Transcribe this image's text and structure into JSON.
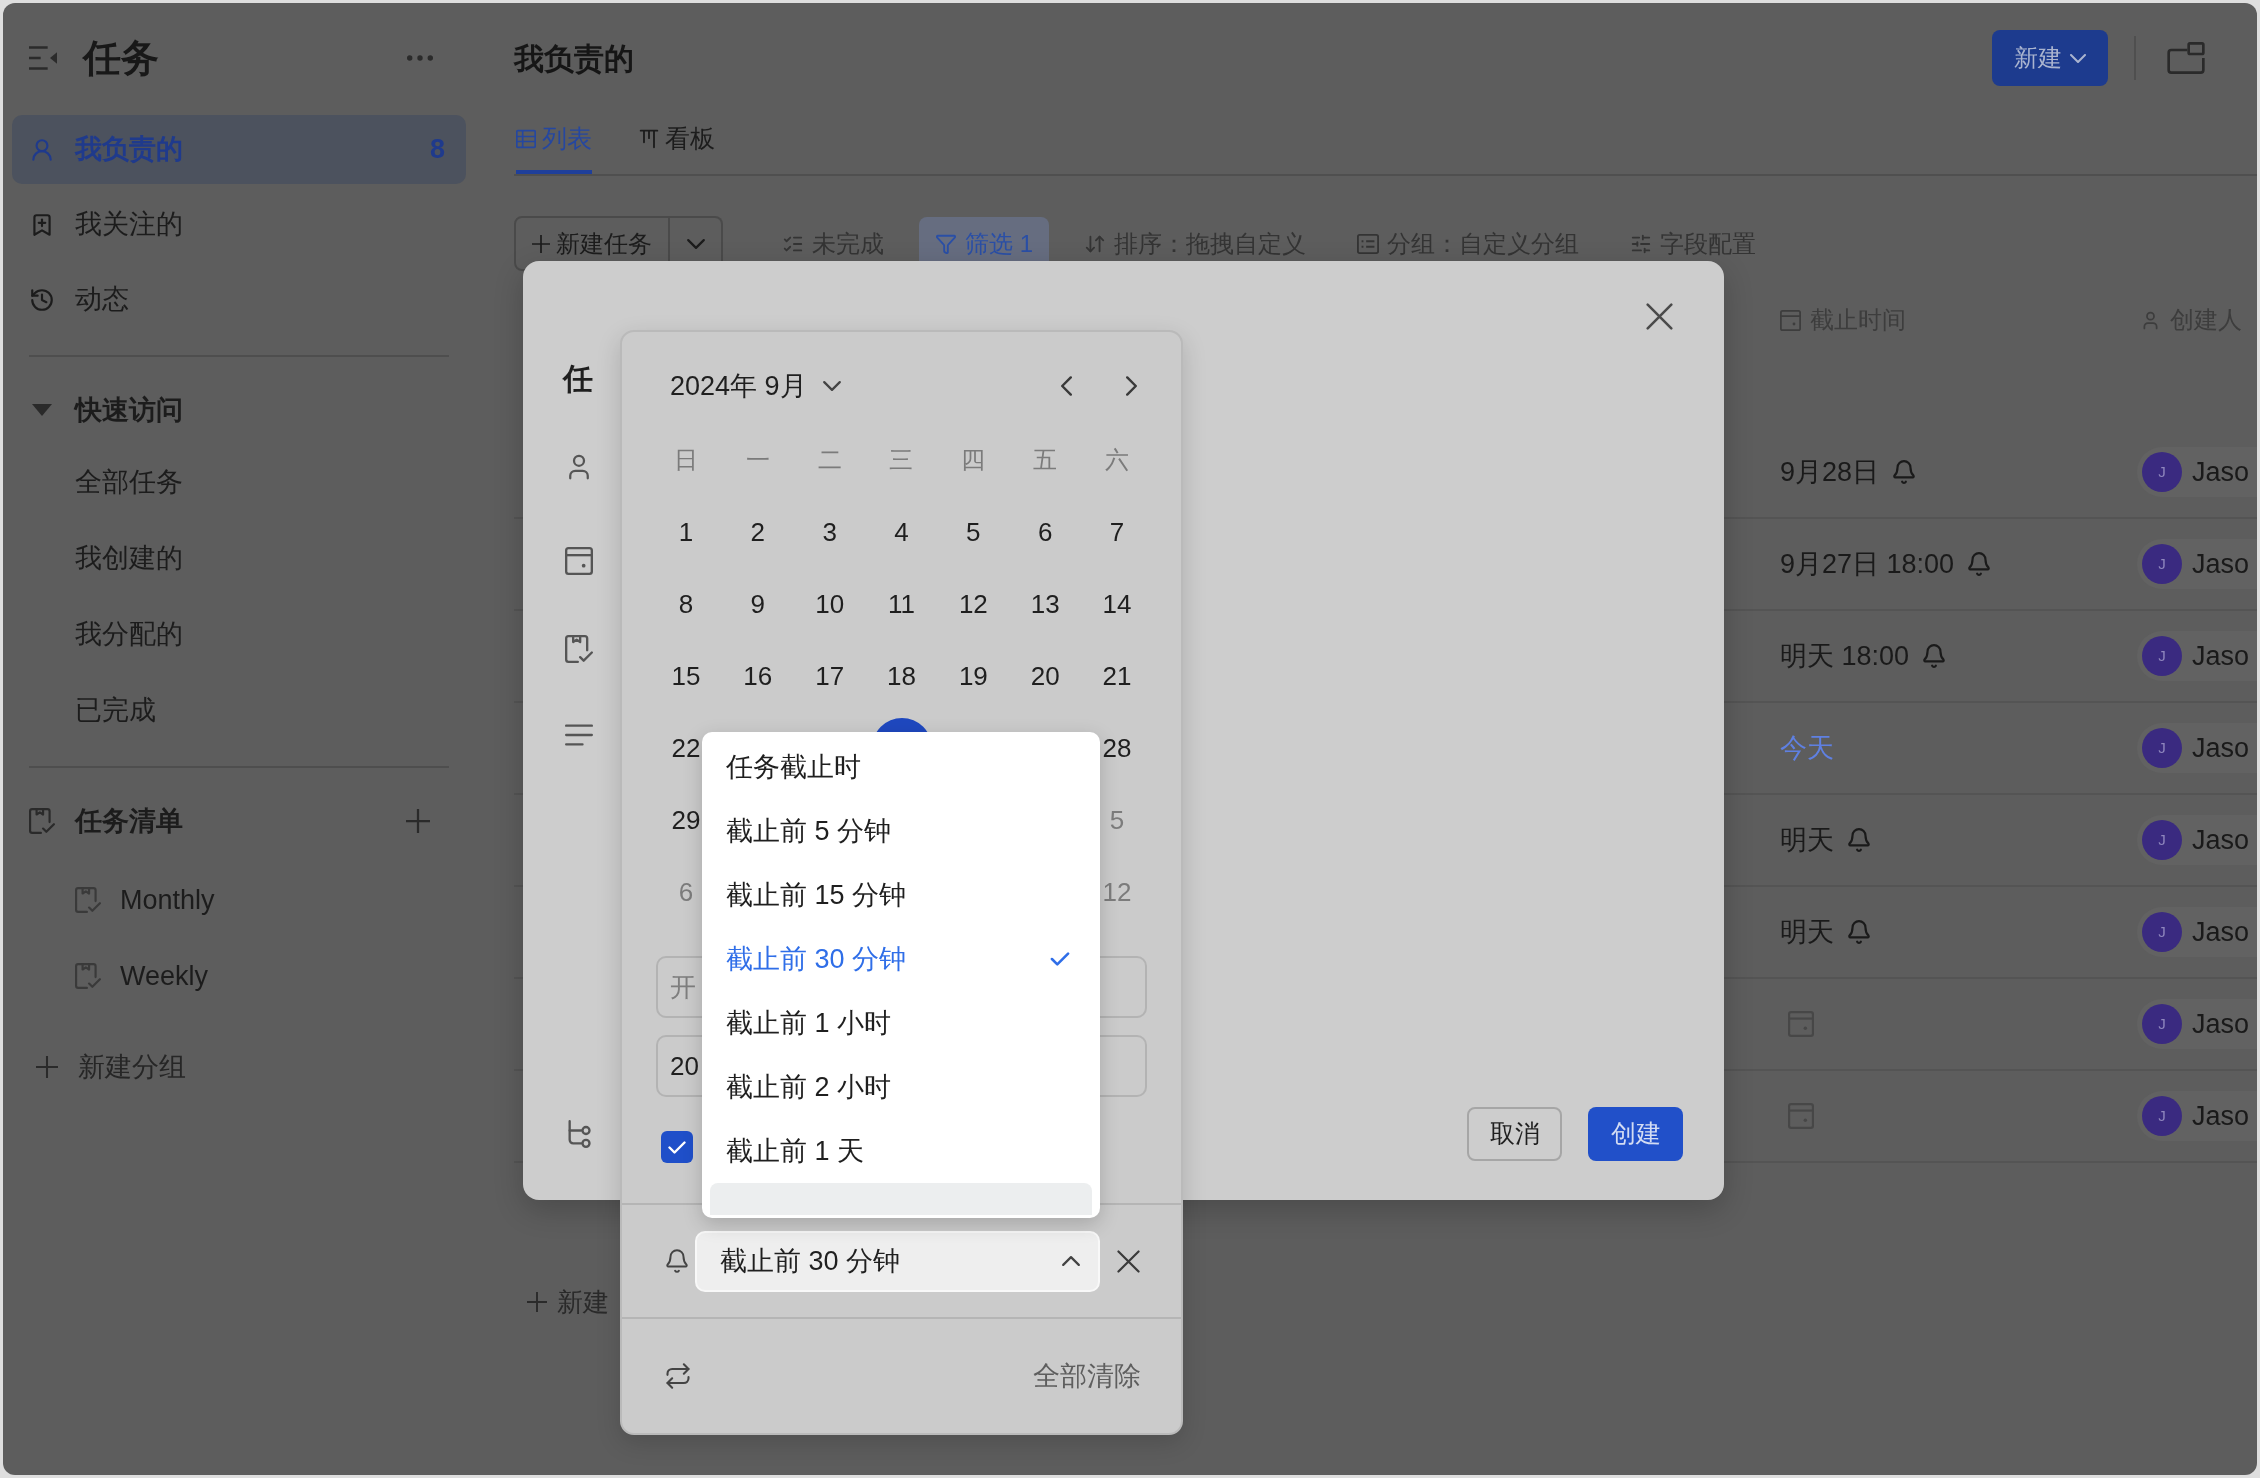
{
  "sidebar": {
    "title": "任务",
    "nav": [
      {
        "kind": "mine",
        "label": "我负责的",
        "count": "8",
        "selected": true
      },
      {
        "kind": "following",
        "label": "我关注的",
        "selected": false
      },
      {
        "kind": "activity",
        "label": "动态",
        "selected": false
      }
    ],
    "quick_access": {
      "title": "快速访问",
      "expanded": true,
      "items": [
        {
          "label": "全部任务",
          "selected": false
        },
        {
          "label": "我创建的",
          "selected": false
        },
        {
          "label": "我分配的",
          "selected": false
        },
        {
          "label": "已完成",
          "selected": false
        }
      ]
    },
    "task_lists": {
      "title": "任务清单",
      "items": [
        {
          "label": "Monthly",
          "selected": false
        },
        {
          "label": "Weekly",
          "selected": false
        }
      ]
    },
    "new_group": "新建分组"
  },
  "header": {
    "title": "我负责的",
    "new_button": "新建"
  },
  "tabs": [
    {
      "kind": "list",
      "label": "列表",
      "selected": true
    },
    {
      "kind": "board",
      "label": "看板",
      "selected": false
    }
  ],
  "toolbar": {
    "new_task": "新建任务",
    "items": [
      {
        "kind": "status",
        "label": "未完成",
        "active": false
      },
      {
        "kind": "filter",
        "label": "筛选 1",
        "active": true
      },
      {
        "kind": "sort",
        "label": "排序：拖拽自定义",
        "active": false
      },
      {
        "kind": "group",
        "label": "分组：自定义分组",
        "active": false
      },
      {
        "kind": "fields",
        "label": "字段配置",
        "active": false
      }
    ]
  },
  "table": {
    "columns": [
      {
        "kind": "due",
        "label": "截止时间"
      },
      {
        "kind": "creator",
        "label": "创建人"
      }
    ],
    "rows": [
      {
        "due": "9月28日",
        "reminder": true,
        "today": false,
        "creator": {
          "initial": "J",
          "name": "Jaso"
        }
      },
      {
        "due": "9月27日 18:00",
        "reminder": true,
        "today": false,
        "creator": {
          "initial": "J",
          "name": "Jaso"
        }
      },
      {
        "due": "明天 18:00",
        "reminder": true,
        "today": false,
        "creator": {
          "initial": "J",
          "name": "Jaso"
        }
      },
      {
        "due": "今天",
        "reminder": false,
        "today": true,
        "creator": {
          "initial": "J",
          "name": "Jaso"
        }
      },
      {
        "due": "明天",
        "reminder": true,
        "today": false,
        "creator": {
          "initial": "J",
          "name": "Jaso"
        }
      },
      {
        "due": "明天",
        "reminder": true,
        "today": false,
        "creator": {
          "initial": "J",
          "name": "Jaso"
        }
      },
      {
        "reminder": false,
        "creator": {
          "initial": "J",
          "name": "Jaso"
        }
      },
      {
        "reminder": false,
        "creator": {
          "initial": "J",
          "name": "Jaso"
        }
      }
    ],
    "add_row": "新建"
  },
  "task_dialog": {
    "title": "任",
    "buttons": [
      {
        "kind": "secondary",
        "label": "取消"
      },
      {
        "kind": "primary",
        "label": "创建"
      }
    ]
  },
  "date_picker": {
    "month": "2024年 9月",
    "weekdays": [
      "日",
      "一",
      "二",
      "三",
      "四",
      "五",
      "六"
    ],
    "weeks": [
      [
        {
          "kind": "day",
          "label": "1",
          "muted": false,
          "selected": false
        },
        {
          "kind": "day",
          "label": "2",
          "muted": false,
          "selected": false
        },
        {
          "kind": "day",
          "label": "3",
          "muted": false,
          "selected": false
        },
        {
          "kind": "day",
          "label": "4",
          "muted": false,
          "selected": false
        },
        {
          "kind": "day",
          "label": "5",
          "muted": false,
          "selected": false
        },
        {
          "kind": "day",
          "label": "6",
          "muted": false,
          "selected": false
        },
        {
          "kind": "day",
          "label": "7",
          "muted": false,
          "selected": false
        }
      ],
      [
        {
          "kind": "day",
          "label": "8",
          "muted": false,
          "selected": false
        },
        {
          "kind": "day",
          "label": "9",
          "muted": false,
          "selected": false
        },
        {
          "kind": "day",
          "label": "10",
          "muted": false,
          "selected": false
        },
        {
          "kind": "day",
          "label": "11",
          "muted": false,
          "selected": false
        },
        {
          "kind": "day",
          "label": "12",
          "muted": false,
          "selected": false
        },
        {
          "kind": "day",
          "label": "13",
          "muted": false,
          "selected": false
        },
        {
          "kind": "day",
          "label": "14",
          "muted": false,
          "selected": false
        }
      ],
      [
        {
          "kind": "day",
          "label": "15",
          "muted": false,
          "selected": false
        },
        {
          "kind": "day",
          "label": "16",
          "muted": false,
          "selected": false
        },
        {
          "kind": "day",
          "label": "17",
          "muted": false,
          "selected": false
        },
        {
          "kind": "day",
          "label": "18",
          "muted": false,
          "selected": false
        },
        {
          "kind": "day",
          "label": "19",
          "muted": false,
          "selected": false
        },
        {
          "kind": "day",
          "label": "20",
          "muted": false,
          "selected": false
        },
        {
          "kind": "day",
          "label": "21",
          "muted": false,
          "selected": false
        }
      ],
      [
        {
          "kind": "day",
          "label": "22",
          "muted": false,
          "selected": false
        },
        {
          "kind": "covered"
        },
        {
          "kind": "covered"
        },
        {
          "kind": "covered",
          "selected": true
        },
        {
          "kind": "covered"
        },
        {
          "kind": "covered"
        },
        {
          "kind": "day",
          "label": "28",
          "muted": false,
          "selected": false
        }
      ],
      [
        {
          "kind": "day",
          "label": "29",
          "muted": false,
          "selected": false
        },
        {
          "kind": "covered"
        },
        {
          "kind": "covered"
        },
        {
          "kind": "covered"
        },
        {
          "kind": "covered"
        },
        {
          "kind": "covered"
        },
        {
          "kind": "day",
          "label": "5",
          "muted": true,
          "selected": false
        }
      ],
      [
        {
          "kind": "day",
          "label": "6",
          "muted": true,
          "selected": false
        },
        {
          "kind": "covered"
        },
        {
          "kind": "covered"
        },
        {
          "kind": "covered"
        },
        {
          "kind": "covered"
        },
        {
          "kind": "covered"
        },
        {
          "kind": "day",
          "label": "12",
          "muted": true,
          "selected": false
        }
      ]
    ],
    "start_field": {
      "placeholder": "开"
    },
    "end_field": {
      "value": "20"
    },
    "all_day": {
      "checked": true
    },
    "reminder": {
      "value": "截止前 30 分钟",
      "expanded": true,
      "options": [
        {
          "label": "任务截止时",
          "selected": false,
          "hovered": false
        },
        {
          "label": "截止前 5 分钟",
          "selected": false,
          "hovered": false
        },
        {
          "label": "截止前 15 分钟",
          "selected": false,
          "hovered": false
        },
        {
          "label": "截止前 30 分钟",
          "selected": true,
          "hovered": false
        },
        {
          "label": "截止前 1 小时",
          "selected": false,
          "hovered": false
        },
        {
          "label": "截止前 2 小时",
          "selected": false,
          "hovered": false
        },
        {
          "label": "截止前 1 天",
          "selected": false,
          "hovered": false
        },
        {
          "selected": false,
          "hovered": true
        }
      ]
    },
    "clear_all": "全部清除"
  }
}
